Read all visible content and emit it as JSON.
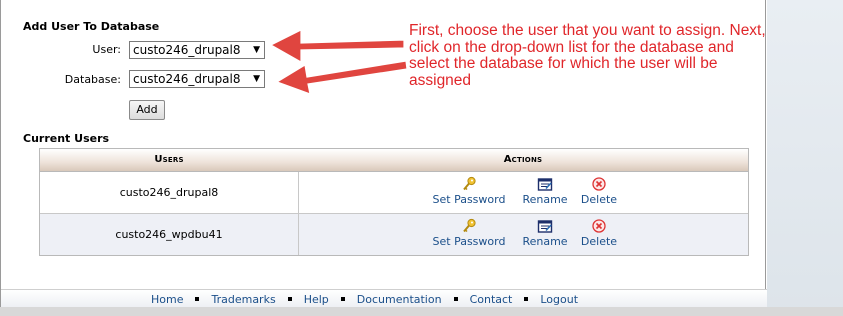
{
  "add_section": {
    "title": "Add User To Database",
    "user_label": "User:",
    "user_value": "custo246_drupal8",
    "database_label": "Database:",
    "database_value": "custo246_drupal8",
    "add_button": "Add"
  },
  "annotation": {
    "text": "First, choose the user that you want to assign.  Next, click on the drop-down list for the database and select the database for which the user will be assigned",
    "color": "#e0262a"
  },
  "current_users": {
    "title": "Current Users",
    "columns": [
      "Users",
      "Actions"
    ],
    "rows": [
      {
        "user": "custo246_drupal8"
      },
      {
        "user": "custo246_wpdbu41"
      }
    ],
    "actions": {
      "set_password": "Set Password",
      "rename": "Rename",
      "delete": "Delete"
    }
  },
  "footer": {
    "links": [
      "Home",
      "Trademarks",
      "Help",
      "Documentation",
      "Contact",
      "Logout"
    ]
  },
  "colors": {
    "link": "#1b4f8a",
    "annotation": "#e0262a",
    "header_gradient_end": "#d9c8ba"
  }
}
